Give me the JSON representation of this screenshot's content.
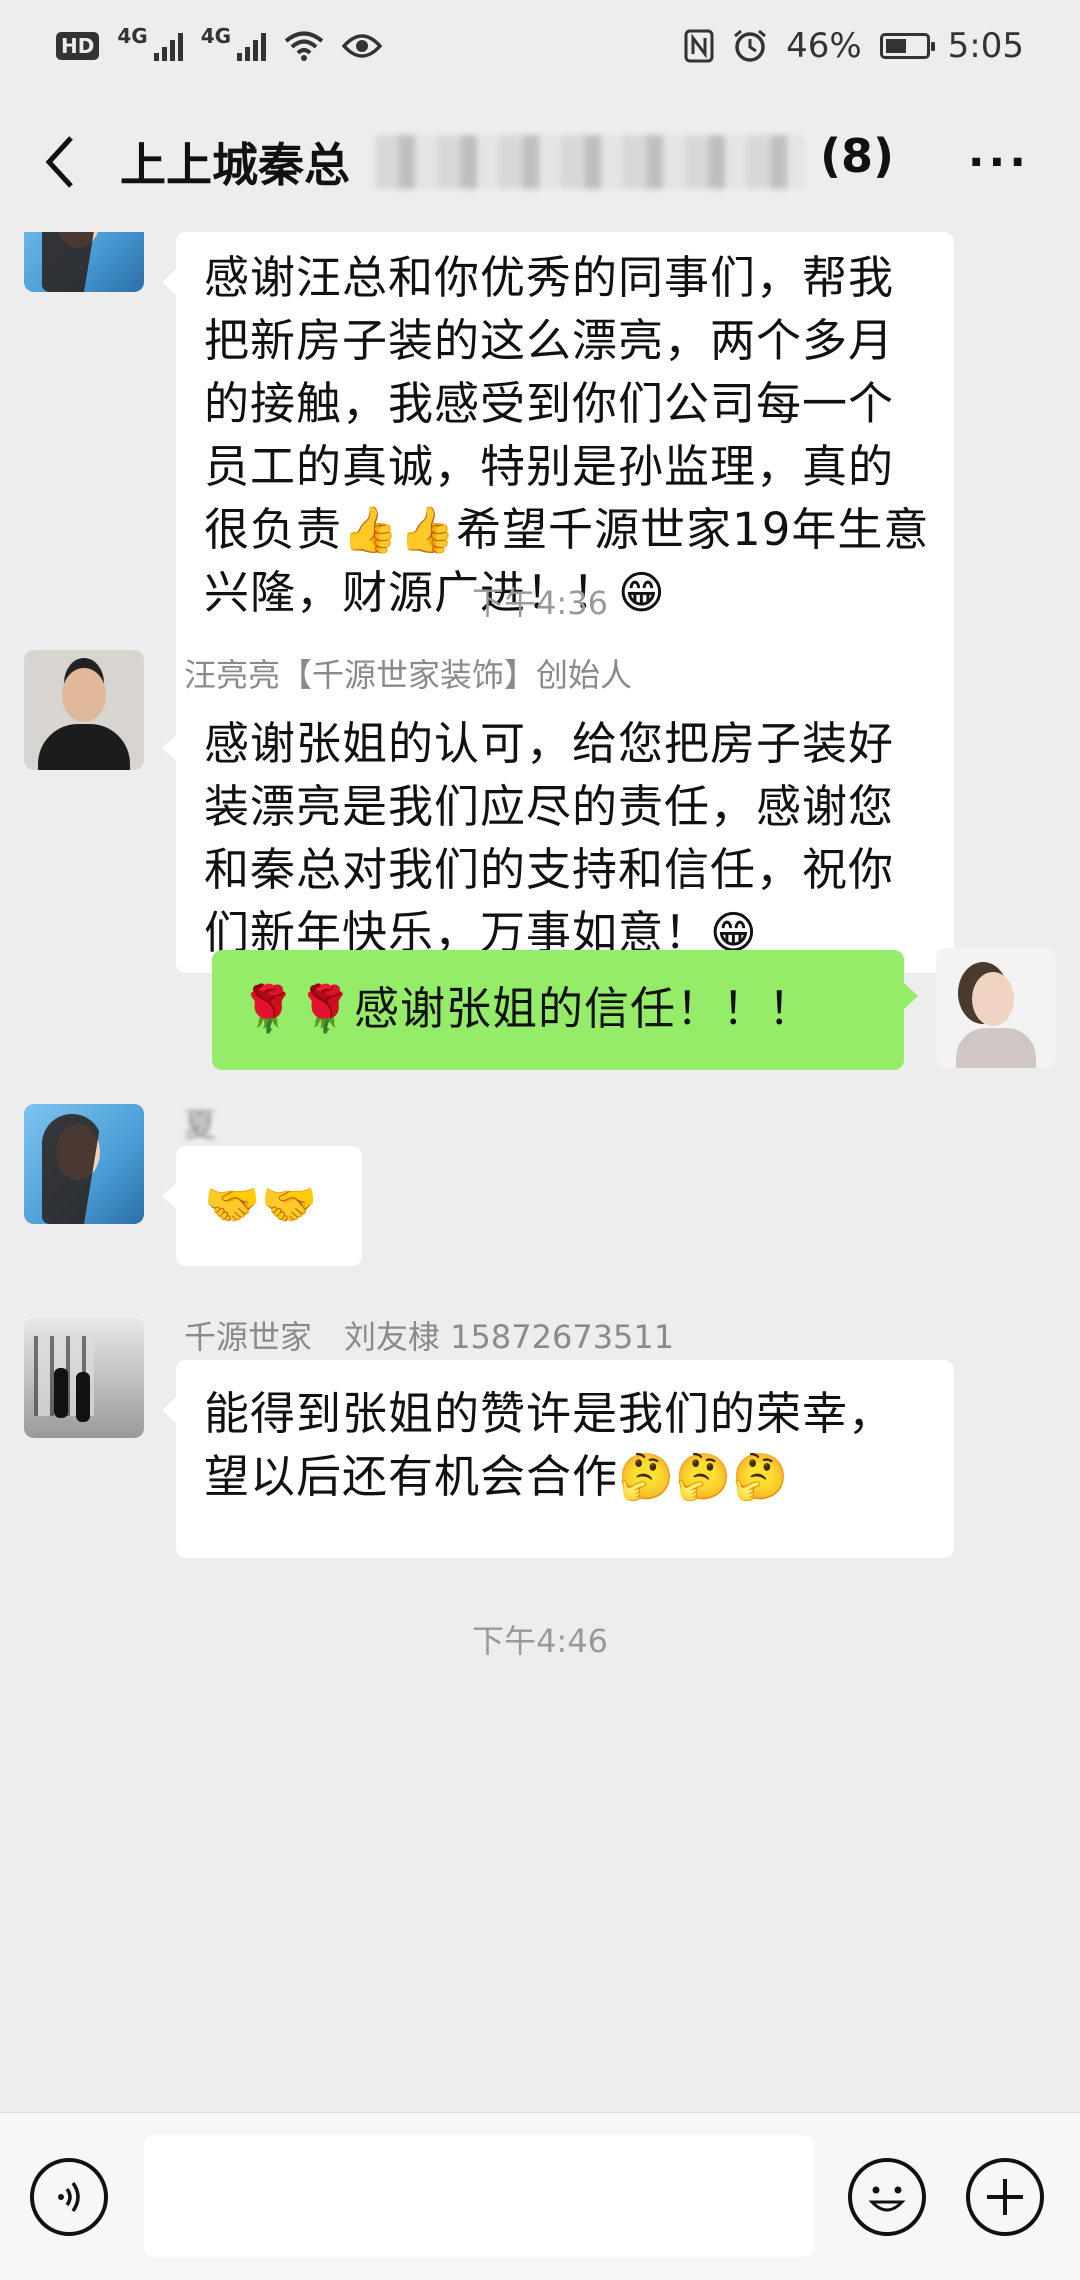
{
  "status_bar": {
    "hd": "HD",
    "net1": "4G",
    "net2": "4G",
    "battery_percent": "46%",
    "time": "5:05",
    "icons": [
      "wifi-icon",
      "eye-icon",
      "nfc-icon",
      "alarm-icon",
      "battery-icon"
    ]
  },
  "header": {
    "title_visible": "上上城秦总",
    "count": "(8)",
    "more": "···"
  },
  "messages": [
    {
      "id": "m1",
      "side": "left",
      "text": "感谢汪总和你优秀的同事们，帮我把新房子装的这么漂亮，两个多月的接触，我感受到你们公司每一个员工的真诚，特别是孙监理，真的很负责👍👍希望千源世家19年生意兴隆，财源广进！！😁"
    },
    {
      "id": "t1",
      "type": "time",
      "text": "下午4:36"
    },
    {
      "id": "m2",
      "side": "left",
      "sender": "汪亮亮【千源世家装饰】创始人",
      "text": "感谢张姐的认可，给您把房子装好装漂亮是我们应尽的责任，感谢您和秦总对我们的支持和信任，祝你们新年快乐，万事如意！😁"
    },
    {
      "id": "m3",
      "side": "right",
      "text": "🌹🌹感谢张姐的信任！！！"
    },
    {
      "id": "m4",
      "side": "left",
      "sender": "夏",
      "text": "🤝🤝"
    },
    {
      "id": "m5",
      "side": "left",
      "sender": "千源世家　刘友棣 15872673511",
      "text": "能得到张姐的赞许是我们的荣幸，望以后还有机会合作🤔🤔🤔"
    },
    {
      "id": "t2",
      "type": "time",
      "text": "下午4:46"
    }
  ],
  "input_bar": {
    "icons": [
      "voice-icon",
      "emoji-icon",
      "plus-icon"
    ]
  },
  "colors": {
    "background": "#ededed",
    "bubble_self": "#95ec69",
    "bubble_other": "#ffffff"
  }
}
